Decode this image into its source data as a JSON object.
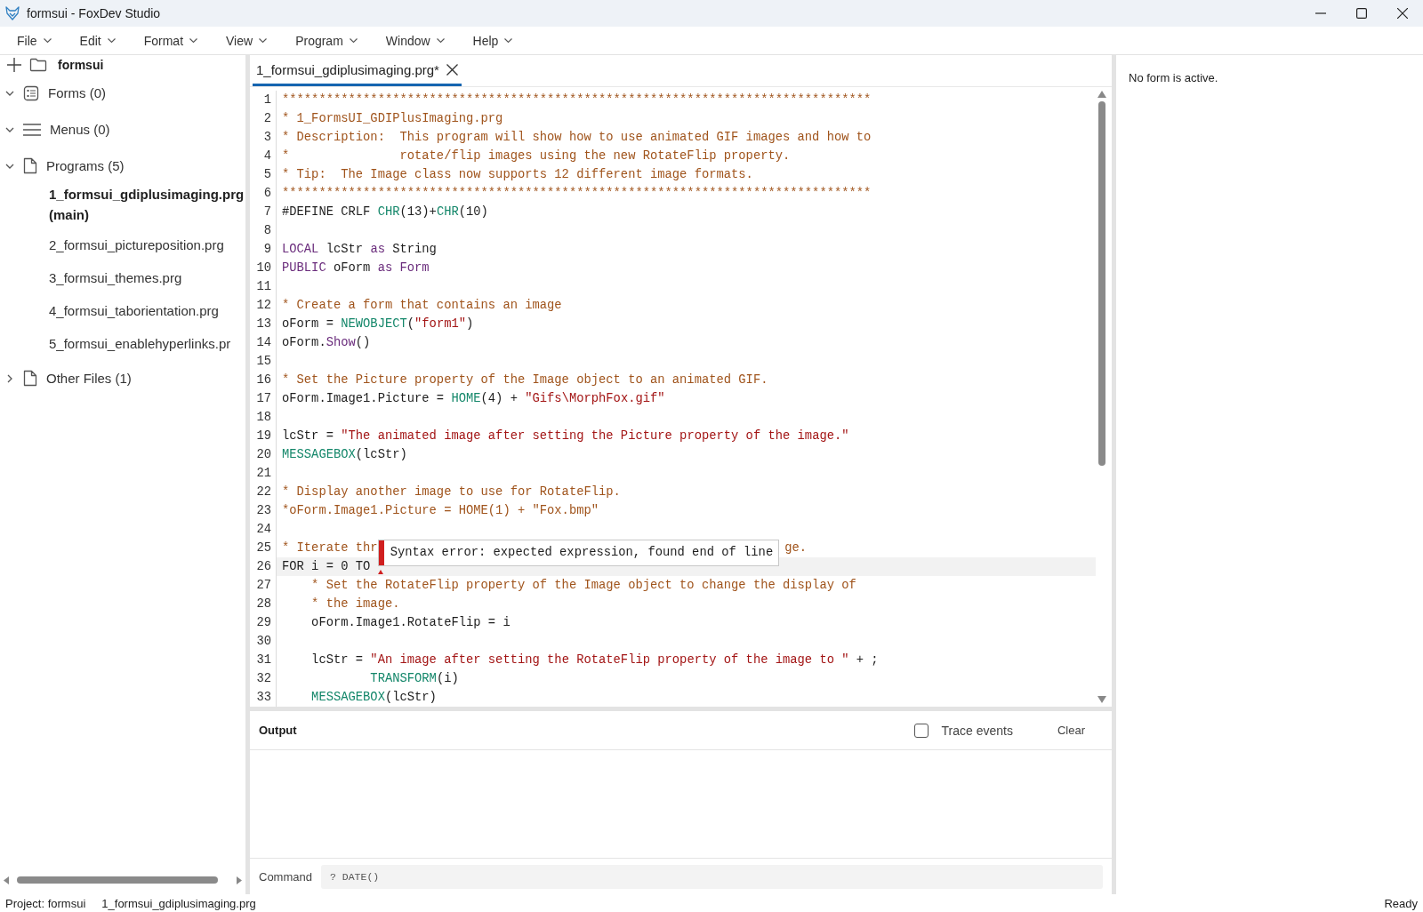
{
  "window": {
    "title": "formsui - FoxDev Studio"
  },
  "menu": [
    "File",
    "Edit",
    "Format",
    "View",
    "Program",
    "Window",
    "Help"
  ],
  "project_tree": {
    "root": "formsui",
    "groups": [
      {
        "label": "Forms (0)",
        "kind": "forms",
        "expanded": true
      },
      {
        "label": "Menus (0)",
        "kind": "menus",
        "expanded": true
      },
      {
        "label": "Programs (5)",
        "kind": "files",
        "expanded": true,
        "children": [
          {
            "label": "1_formsui_gdiplusimaging.prg (main)",
            "selected": true
          },
          {
            "label": "2_formsui_pictureposition.prg",
            "selected": false
          },
          {
            "label": "3_formsui_themes.prg",
            "selected": false
          },
          {
            "label": "4_formsui_taborientation.prg",
            "selected": false
          },
          {
            "label": "5_formsui_enablehyperlinks.pr",
            "selected": false
          }
        ]
      },
      {
        "label": "Other Files (1)",
        "kind": "files",
        "expanded": false
      }
    ]
  },
  "editor": {
    "tabs": [
      {
        "label": "1_formsui_gdiplusimaging.prg*",
        "selected": true
      }
    ],
    "lines": [
      {
        "number": "1",
        "current": false,
        "error": false,
        "segments": [
          {
            "kind": "comment",
            "text": "********************************************************************************"
          }
        ]
      },
      {
        "number": "2",
        "current": false,
        "error": false,
        "segments": [
          {
            "kind": "comment",
            "text": "* 1_FormsUI_GDIPlusImaging.prg"
          }
        ]
      },
      {
        "number": "3",
        "current": false,
        "error": false,
        "segments": [
          {
            "kind": "comment",
            "text": "* Description:  This program will show how to use animated GIF images and how to"
          }
        ]
      },
      {
        "number": "4",
        "current": false,
        "error": false,
        "segments": [
          {
            "kind": "comment",
            "text": "*               rotate/flip images using the new RotateFlip property."
          }
        ]
      },
      {
        "number": "5",
        "current": false,
        "error": false,
        "segments": [
          {
            "kind": "comment",
            "text": "* Tip:  The Image class now supports 12 different image formats."
          }
        ]
      },
      {
        "number": "6",
        "current": false,
        "error": false,
        "segments": [
          {
            "kind": "comment",
            "text": "********************************************************************************"
          }
        ]
      },
      {
        "number": "7",
        "current": false,
        "error": false,
        "segments": [
          {
            "kind": "plain",
            "text": "#DEFINE CRLF "
          },
          {
            "kind": "function",
            "text": "CHR"
          },
          {
            "kind": "plain",
            "text": "(13)+"
          },
          {
            "kind": "function",
            "text": "CHR"
          },
          {
            "kind": "plain",
            "text": "(10)"
          }
        ]
      },
      {
        "number": "8",
        "current": false,
        "error": false
      },
      {
        "number": "9",
        "current": false,
        "error": false,
        "segments": [
          {
            "kind": "keyword",
            "text": "LOCAL"
          },
          {
            "kind": "plain",
            "text": " lcStr "
          },
          {
            "kind": "keyword",
            "text": "as"
          },
          {
            "kind": "plain",
            "text": " String"
          }
        ]
      },
      {
        "number": "10",
        "current": false,
        "error": false,
        "segments": [
          {
            "kind": "keyword",
            "text": "PUBLIC"
          },
          {
            "kind": "plain",
            "text": " oForm "
          },
          {
            "kind": "keyword",
            "text": "as Form"
          }
        ]
      },
      {
        "number": "11",
        "current": false,
        "error": false
      },
      {
        "number": "12",
        "current": false,
        "error": false,
        "segments": [
          {
            "kind": "comment",
            "text": "* Create a form that contains an image"
          }
        ]
      },
      {
        "number": "13",
        "current": false,
        "error": false,
        "segments": [
          {
            "kind": "plain",
            "text": "oForm = "
          },
          {
            "kind": "function",
            "text": "NEWOBJECT"
          },
          {
            "kind": "plain",
            "text": "("
          },
          {
            "kind": "string",
            "text": "\"form1\""
          },
          {
            "kind": "plain",
            "text": ")"
          }
        ]
      },
      {
        "number": "14",
        "current": false,
        "error": false,
        "segments": [
          {
            "kind": "plain",
            "text": "oForm."
          },
          {
            "kind": "keyword",
            "text": "Show"
          },
          {
            "kind": "plain",
            "text": "()"
          }
        ]
      },
      {
        "number": "15",
        "current": false,
        "error": false
      },
      {
        "number": "16",
        "current": false,
        "error": false,
        "segments": [
          {
            "kind": "comment",
            "text": "* Set the Picture property of the Image object to an animated GIF."
          }
        ]
      },
      {
        "number": "17",
        "current": false,
        "error": false,
        "segments": [
          {
            "kind": "plain",
            "text": "oForm.Image1.Picture = "
          },
          {
            "kind": "function",
            "text": "HOME"
          },
          {
            "kind": "plain",
            "text": "(4) + "
          },
          {
            "kind": "string",
            "text": "\"Gifs\\MorphFox.gif\""
          }
        ]
      },
      {
        "number": "18",
        "current": false,
        "error": false
      },
      {
        "number": "19",
        "current": false,
        "error": false,
        "segments": [
          {
            "kind": "plain",
            "text": "lcStr = "
          },
          {
            "kind": "string",
            "text": "\"The animated image after setting the Picture property of the image.\""
          }
        ]
      },
      {
        "number": "20",
        "current": false,
        "error": false,
        "segments": [
          {
            "kind": "function",
            "text": "MESSAGEBOX"
          },
          {
            "kind": "plain",
            "text": "(lcStr)"
          }
        ]
      },
      {
        "number": "21",
        "current": false,
        "error": false
      },
      {
        "number": "22",
        "current": false,
        "error": false,
        "segments": [
          {
            "kind": "comment",
            "text": "* Display another image to use for RotateFlip."
          }
        ]
      },
      {
        "number": "23",
        "current": false,
        "error": false,
        "segments": [
          {
            "kind": "comment",
            "text": "*oForm.Image1.Picture = HOME(1) + \"Fox.bmp\""
          }
        ]
      },
      {
        "number": "24",
        "current": false,
        "error": false
      },
      {
        "number": "25",
        "current": false,
        "error": false,
        "segments": [
          {
            "kind": "comment",
            "text": "* Iterate thr"
          },
          {
            "kind": "error_tooltip",
            "text": "Syntax error: expected expression, found end of line"
          },
          {
            "kind": "comment",
            "text": "ge."
          }
        ]
      },
      {
        "number": "26",
        "current": true,
        "error": true,
        "segments": [
          {
            "kind": "plain",
            "text": "FOR i = 0 TO "
          }
        ]
      },
      {
        "number": "27",
        "current": false,
        "error": false,
        "segments": [
          {
            "kind": "comment",
            "text": "    * Set the RotateFlip property of the Image object to change the display of"
          }
        ]
      },
      {
        "number": "28",
        "current": false,
        "error": false,
        "segments": [
          {
            "kind": "comment",
            "text": "    * the image."
          }
        ]
      },
      {
        "number": "29",
        "current": false,
        "error": false,
        "segments": [
          {
            "kind": "plain",
            "text": "    oForm.Image1.RotateFlip = i"
          }
        ]
      },
      {
        "number": "30",
        "current": false,
        "error": false
      },
      {
        "number": "31",
        "current": false,
        "error": false,
        "segments": [
          {
            "kind": "plain",
            "text": "    lcStr = "
          },
          {
            "kind": "string",
            "text": "\"An image after setting the RotateFlip property of the image to \""
          },
          {
            "kind": "plain",
            "text": " + ;"
          }
        ]
      },
      {
        "number": "32",
        "current": false,
        "error": false,
        "segments": [
          {
            "kind": "function",
            "text": "            TRANSFORM"
          },
          {
            "kind": "plain",
            "text": "(i)"
          }
        ]
      },
      {
        "number": "33",
        "current": false,
        "error": false,
        "segments": [
          {
            "kind": "function",
            "text": "    MESSAGEBOX"
          },
          {
            "kind": "plain",
            "text": "(lcStr)"
          }
        ]
      }
    ]
  },
  "output": {
    "title": "Output",
    "trace_events": {
      "label": "Trace events",
      "checked": false
    },
    "clear_button": "Clear",
    "command": {
      "label": "Command",
      "placeholder": "? DATE()"
    }
  },
  "properties_panel": {
    "message": "No form is active."
  },
  "status_bar": {
    "project": "Project: formsui",
    "file": "1_formsui_gdiplusimaging.prg",
    "status": "Ready"
  }
}
